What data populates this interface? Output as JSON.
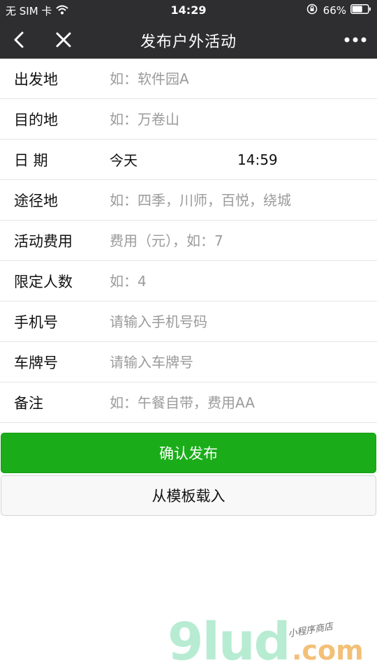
{
  "status_bar": {
    "carrier": "无 SIM 卡",
    "time": "14:29",
    "battery_percent": "66%",
    "battery_level": 0.66
  },
  "nav": {
    "title": "发布户外活动"
  },
  "form": {
    "departure": {
      "label": "出发地",
      "placeholder": "如：软件园A"
    },
    "destination": {
      "label": "目的地",
      "placeholder": "如：万卷山"
    },
    "date": {
      "label": "日 期",
      "date_value": "今天",
      "time_value": "14:59"
    },
    "waypoints": {
      "label": "途径地",
      "placeholder": "如：四季，川师，百悦，绕城"
    },
    "fee": {
      "label": "活动费用",
      "placeholder": "费用（元），如：7"
    },
    "limit": {
      "label": "限定人数",
      "placeholder": "如：4"
    },
    "phone": {
      "label": "手机号",
      "placeholder": "请输入手机号码"
    },
    "plate": {
      "label": "车牌号",
      "placeholder": "请输入车牌号"
    },
    "remark": {
      "label": "备注",
      "placeholder": "如：午餐自带，费用AA"
    }
  },
  "buttons": {
    "confirm": "确认发布",
    "load_template": "从模板载入"
  },
  "watermark": {
    "brand": "9lud",
    "suffix": ".com",
    "tagline": "小程序商店"
  },
  "colors": {
    "bar_bg": "#2e2e30",
    "primary_green": "#1aad19",
    "placeholder_gray": "#9b9b9b"
  }
}
